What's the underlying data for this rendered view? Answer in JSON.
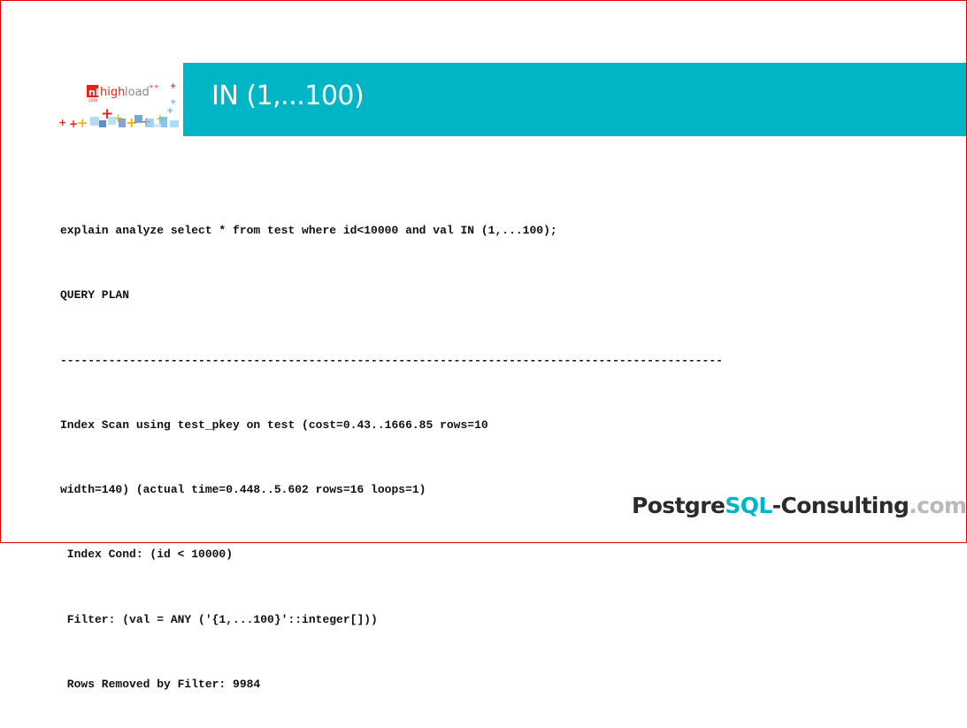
{
  "slide": {
    "title": "IN (1,...100)",
    "logo": {
      "name": "highload",
      "superscript": "++",
      "year": "2016"
    },
    "code_lines": [
      "explain analyze select * from test where id<10000 and val IN (1,...100);",
      "QUERY PLAN",
      "------------------------------------------------------------------------------------------------",
      "Index Scan using test_pkey on test (cost=0.43..1666.85 rows=10",
      "width=140) (actual time=0.448..5.602 rows=16 loops=1)",
      " Index Cond: (id < 10000)",
      " Filter: (val = ANY ('{1,...100}'::integer[]))",
      " Rows Removed by Filter: 9984"
    ],
    "footer": {
      "brand_part1": "Postgre",
      "brand_part2": "SQL",
      "brand_part3": "-Consulting",
      "brand_part4": ".com"
    }
  },
  "colors": {
    "accent": "#00b5c5",
    "frame": "#e00000",
    "logo_red": "#e2231a",
    "brand_dark": "#2b2b2b",
    "brand_gray": "#b9b9b9"
  }
}
